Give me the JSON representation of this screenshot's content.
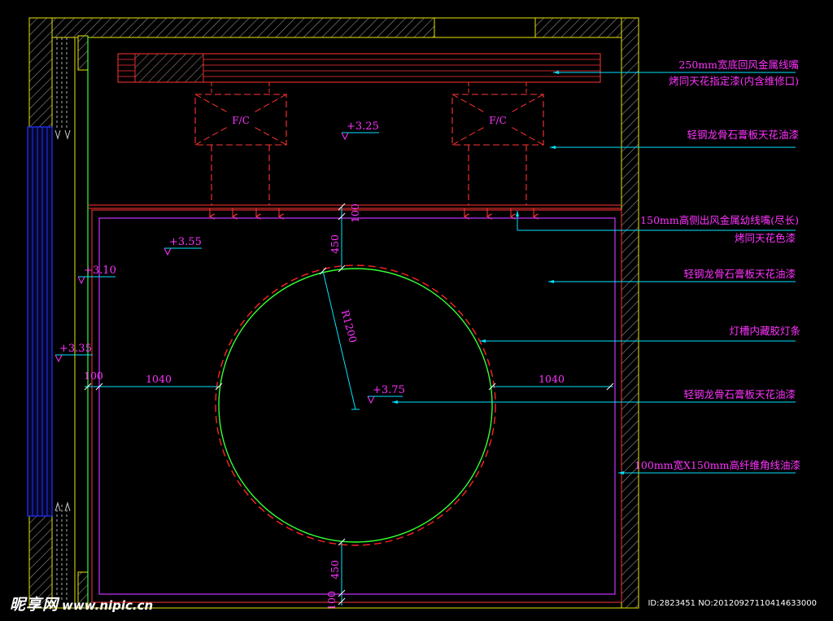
{
  "annotations": [
    {
      "line1": "250mm宽底回风金属线嘴",
      "line2": "烤同天花指定漆(内含维修口)"
    },
    {
      "line1": "轻钢龙骨石膏板天花油漆"
    },
    {
      "line1": "150mm高侧出风金属幼线嘴(尽长)",
      "line2": "烤同天花色漆"
    },
    {
      "line1": "轻钢龙骨石膏板天花油漆"
    },
    {
      "line1": "灯槽内藏胶灯条"
    },
    {
      "line1": "轻钢龙骨石膏板天花油漆"
    },
    {
      "line1": "100mm宽X150mm高纤维角线油漆"
    }
  ],
  "levels": [
    "+3.25",
    "+3.55",
    "+3.10",
    "+3.35",
    "+3.75"
  ],
  "dimensions": {
    "top_gap": "100",
    "top_offset": "450",
    "radius": "R1200",
    "left_small": "100",
    "left_span": "1040",
    "right_span": "1040",
    "bottom_offset": "450",
    "bottom_gap": "100"
  },
  "fan_coil_label": "F/C",
  "watermark": {
    "site": "昵享网",
    "url": "www.nipic.cn"
  },
  "image_id": "ID:2823451 NO:20120927110414633000",
  "colors": {
    "background": "#000000",
    "wall": "#e6e600",
    "ceiling_edge": "#ff3333",
    "annotation": "#ff33ff",
    "leader": "#00e5ff",
    "light_cove": "#33ff33",
    "curtain": "#2233ff"
  }
}
